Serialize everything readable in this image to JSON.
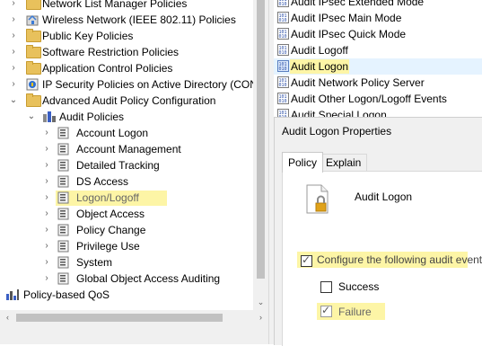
{
  "tree": {
    "items": [
      {
        "label": "Network List Manager Policies",
        "icon": "folder-icon"
      },
      {
        "label": "Wireless Network (IEEE 802.11) Policies",
        "icon": "wireless-policy-icon"
      },
      {
        "label": "Public Key Policies",
        "icon": "folder-icon"
      },
      {
        "label": "Software Restriction Policies",
        "icon": "folder-icon"
      },
      {
        "label": "Application Control Policies",
        "icon": "folder-icon"
      },
      {
        "label": "IP Security Policies on Active Directory (CON",
        "icon": "ip-security-icon"
      },
      {
        "label": "Advanced Audit Policy Configuration",
        "icon": "folder-icon"
      },
      {
        "label": "Audit Policies",
        "icon": "audit-policies-icon"
      },
      {
        "label": "Account Logon",
        "icon": "audit-category-icon"
      },
      {
        "label": "Account Management",
        "icon": "audit-category-icon"
      },
      {
        "label": "Detailed Tracking",
        "icon": "audit-category-icon"
      },
      {
        "label": "DS Access",
        "icon": "audit-category-icon"
      },
      {
        "label": "Logon/Logoff",
        "icon": "audit-category-icon"
      },
      {
        "label": "Object Access",
        "icon": "audit-category-icon"
      },
      {
        "label": "Policy Change",
        "icon": "audit-category-icon"
      },
      {
        "label": "Privilege Use",
        "icon": "audit-category-icon"
      },
      {
        "label": "System",
        "icon": "audit-category-icon"
      },
      {
        "label": "Global Object Access Auditing",
        "icon": "audit-category-icon"
      },
      {
        "label": "Policy-based QoS",
        "icon": "qos-chart-icon"
      }
    ]
  },
  "list": {
    "items": [
      {
        "label": "Audit IPsec Extended Mode"
      },
      {
        "label": "Audit IPsec Main Mode"
      },
      {
        "label": "Audit IPsec Quick Mode"
      },
      {
        "label": "Audit Logoff"
      },
      {
        "label": "Audit Logon"
      },
      {
        "label": "Audit Network Policy Server"
      },
      {
        "label": "Audit Other Logon/Logoff Events"
      },
      {
        "label": "Audit Special Logon"
      }
    ]
  },
  "dialog": {
    "title": "Audit Logon Properties",
    "tabs": [
      "Policy",
      "Explain"
    ],
    "policy_name": "Audit Logon",
    "configure_label": "Configure the following audit events:",
    "configure_checked": true,
    "success_label": "Success",
    "success_checked": false,
    "failure_label": "Failure",
    "failure_checked": true
  },
  "colors": {
    "highlight": "#fdf5a6",
    "selection": "#e5f3ff",
    "folder": "#e8c15c"
  }
}
